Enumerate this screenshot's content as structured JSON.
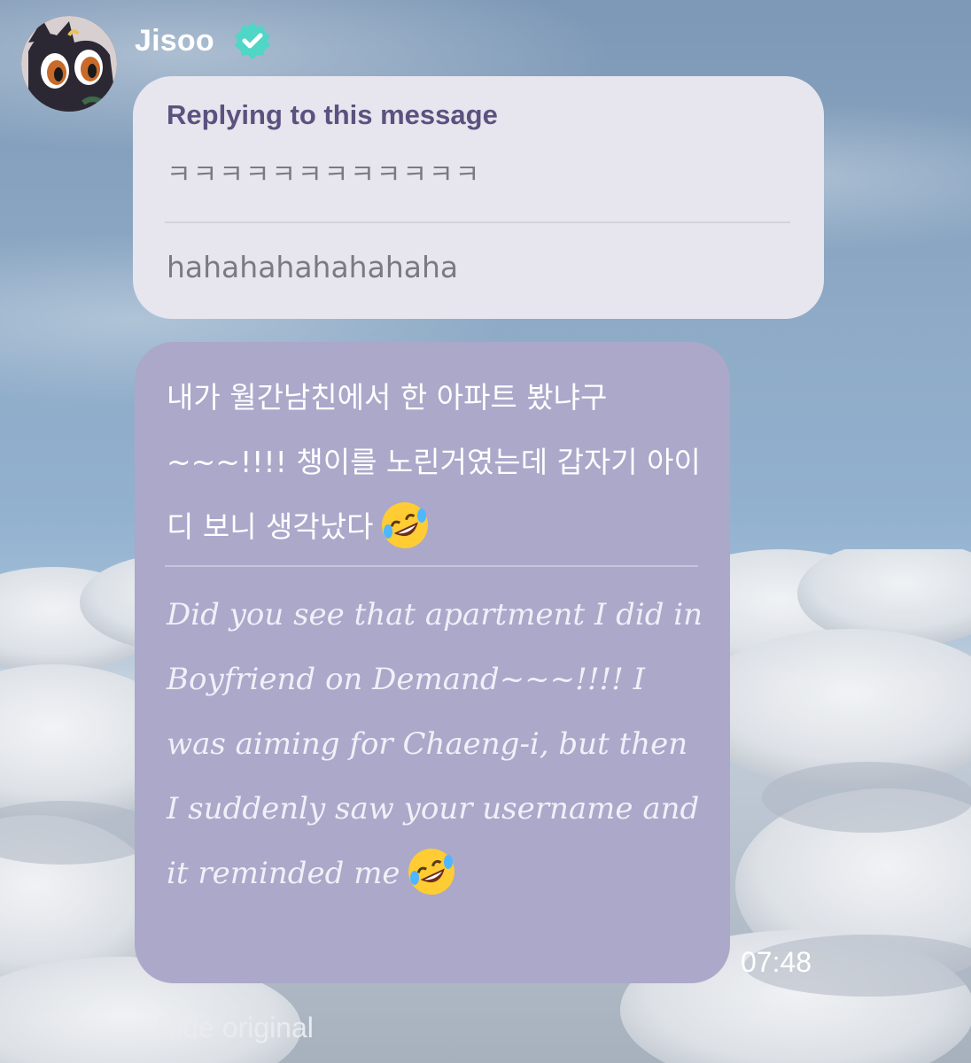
{
  "sender": {
    "name": "Jisoo",
    "verified_icon": "verified-badge-icon",
    "verified_color": "#4fd6c7"
  },
  "reply": {
    "header": "Replying to this message",
    "original": "ㅋㅋㅋㅋㅋㅋㅋㅋㅋㅋㅋㅋ",
    "translation": "hahahahahahahaha",
    "header_color": "#5c527f",
    "background": "#e7e5ee"
  },
  "message": {
    "original": "내가 월간남친에서 한 아파트 봤냐구 ~~~!!!! 챙이를 노린거였는데 갑자기 아이디 보니 생각났다",
    "original_emoji": "rolling-on-floor-laughing-emoji",
    "translation": "Did you see that apartment I did in Boyfriend on Demand~~~!!!! I was aiming for Chaeng-i, but then I suddenly saw your username and it reminded me",
    "translation_emoji": "rolling-on-floor-laughing-emoji",
    "background": "#aba8ca",
    "time": "07:48"
  },
  "actions": {
    "hide_original": "Hide original"
  }
}
